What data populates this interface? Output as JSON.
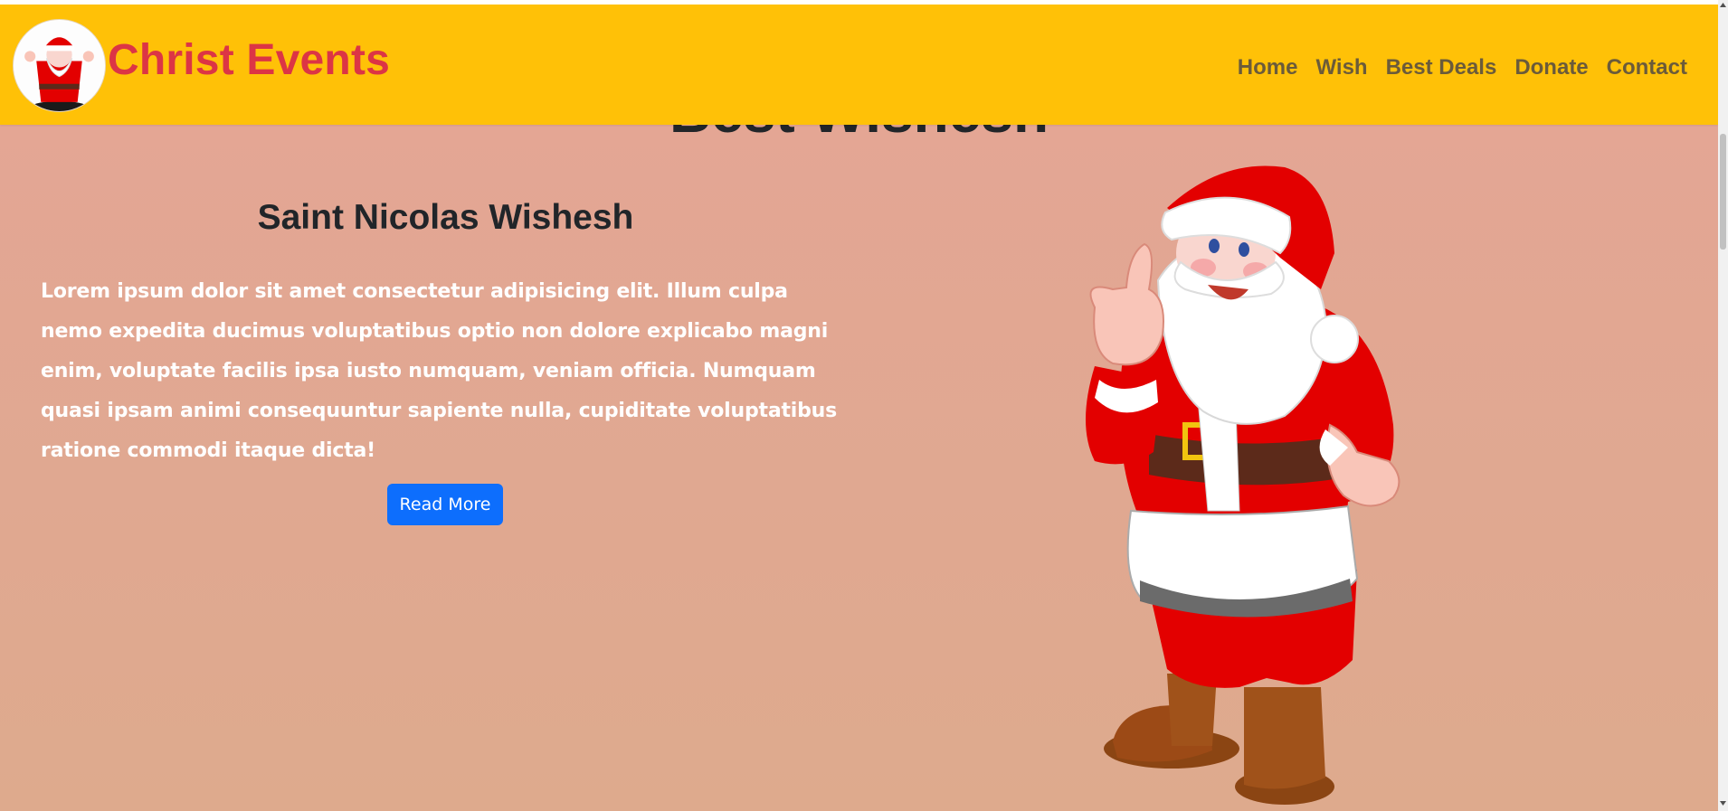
{
  "navbar": {
    "brand_name": "Christ Events",
    "links": [
      {
        "label": "Home"
      },
      {
        "label": "Wish"
      },
      {
        "label": "Best Deals"
      },
      {
        "label": "Donate"
      },
      {
        "label": "Contact"
      }
    ],
    "background": "#ffc107",
    "brand_color": "#dc3545"
  },
  "section": {
    "heading": "Best Wishesh",
    "title": "Saint Nicolas Wishesh",
    "body": "Lorem ipsum dolor sit amet consectetur adipisicing elit. Illum culpa nemo expedita ducimus voluptatibus optio non dolore explicabo magni enim, voluptate facilis ipsa iusto numquam, veniam officia. Numquam quasi ipsam animi consequuntur sapiente nulla, cupiditate voluptatibus ratione commodi itaque dicta!",
    "button_label": "Read More",
    "button_color": "#0d6efd",
    "image": "santa-claus-thumbs-up"
  },
  "icons": {
    "logo": "santa-logo-icon",
    "scroll_up": "scroll-up-arrow-icon",
    "scroll_down": "scroll-down-arrow-icon"
  }
}
